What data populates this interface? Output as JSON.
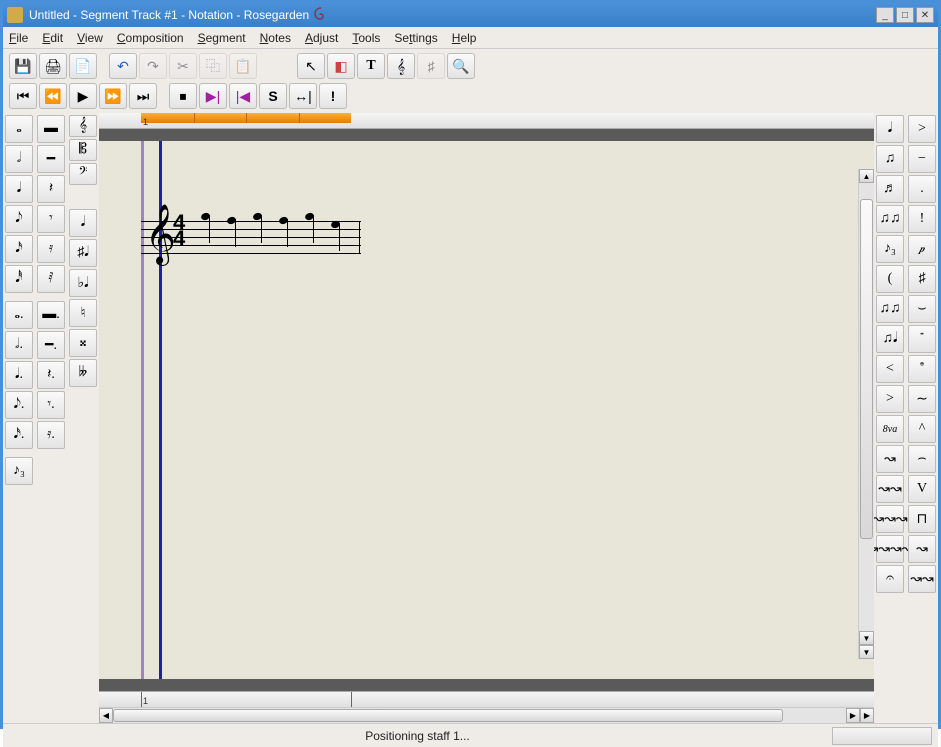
{
  "window": {
    "title": "Untitled - Segment Track #1 - Notation - Rosegarden"
  },
  "menu": {
    "file": "File",
    "edit": "Edit",
    "view": "View",
    "composition": "Composition",
    "segment": "Segment",
    "notes": "Notes",
    "adjust": "Adjust",
    "tools": "Tools",
    "settings": "Settings",
    "help": "Help"
  },
  "toolbar1": {
    "save": "💾",
    "print": "🖨",
    "print_preview": "📄",
    "undo": "↶",
    "redo": "↷",
    "cut": "✂",
    "copy": "⿻",
    "paste": "📋",
    "pointer": "↖",
    "eraser": "◧",
    "text": "T",
    "guitar": "𝄞",
    "marks": "♯",
    "zoom": "🔍"
  },
  "transport": {
    "rewind_start": "⏮",
    "rewind": "⏪",
    "play": "▶",
    "ffwd": "⏩",
    "ffwd_end": "⏭",
    "stop": "⏹",
    "loop_start": "▶|",
    "loop_end": "|◀",
    "solo": "S",
    "loop_toggle": "↔|",
    "panic": "!"
  },
  "left_palette": {
    "durations": [
      "𝅝",
      "𝅗𝅥",
      "𝅘𝅥",
      "𝅘𝅥𝅮",
      "𝅘𝅥𝅯",
      "𝅘𝅥𝅰"
    ],
    "rests": [
      "▬",
      "━",
      "𝄽",
      "𝄾",
      "𝄿",
      "𝅀"
    ],
    "dotted": [
      "𝅝.",
      "𝅗𝅥.",
      "𝅘𝅥.",
      "𝅘𝅥𝅮.",
      "𝅘𝅥𝅯."
    ],
    "dotted_rests": [
      "▬.",
      "━.",
      "𝄽.",
      "𝄾.",
      "𝄿."
    ],
    "triplet": "♪₃",
    "clefs": [
      "𝄞",
      "𝄡",
      "𝄢"
    ],
    "accidentals": [
      "♮",
      "♯",
      "♭",
      "𝄪",
      "𝄫",
      "♮♮"
    ],
    "misc": [
      "𝅘𝅥",
      "♯𝅘𝅥",
      "♭𝅘𝅥"
    ]
  },
  "right_palette": {
    "col1": [
      "𝅘𝅥",
      "♫",
      "♬",
      "♫♫",
      "♪₃",
      "(",
      "♫♫",
      "♫𝅘𝅥",
      "<",
      ">",
      "8va",
      "↝",
      "↝↝",
      "↝↝↝",
      "↝↝↝↝",
      "𝄐"
    ],
    "col2": [
      ">",
      "−",
      ".",
      "!",
      "𝆏",
      "♯",
      "⌣",
      "𝆴",
      "𝆵",
      "∼",
      "^",
      "⌢",
      "V",
      "⊓",
      "↝",
      "↝↝"
    ]
  },
  "ruler": {
    "bar1": "1"
  },
  "score": {
    "time_sig_num": "4",
    "time_sig_den": "4"
  },
  "status": {
    "message": "Positioning staff 1..."
  }
}
